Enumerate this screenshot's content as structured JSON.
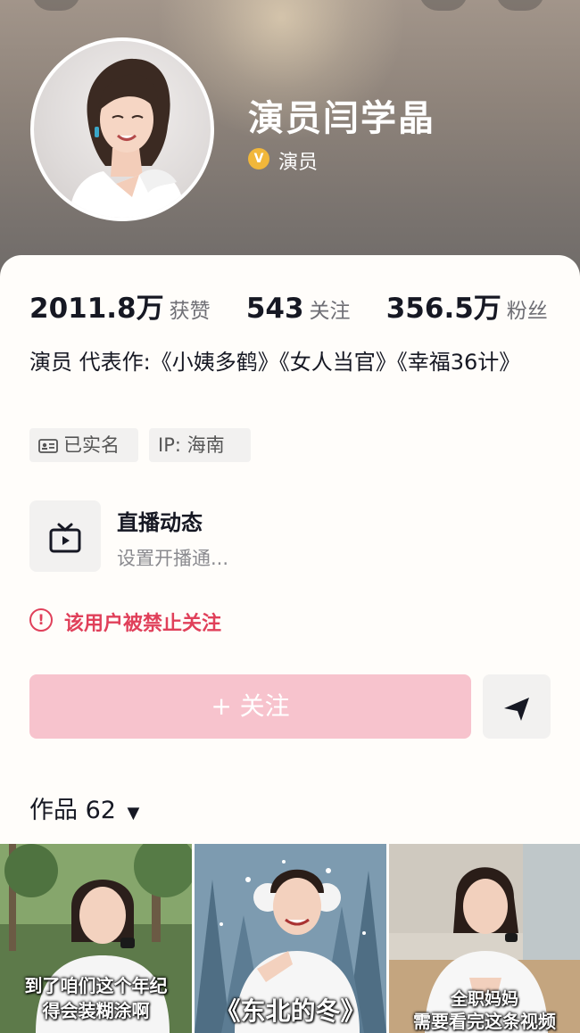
{
  "profile": {
    "name": "演员闫学晶",
    "verify_badge": "V",
    "role": "演员"
  },
  "stats": [
    {
      "value": "2011.8万",
      "label": "获赞"
    },
    {
      "value": "543",
      "label": "关注"
    },
    {
      "value": "356.5万",
      "label": "粉丝"
    }
  ],
  "bio": "演员 代表作:《小姨多鹤》《女人当官》《幸福36计》",
  "tags": {
    "verified": "已实名",
    "ip": "IP:  海南"
  },
  "live": {
    "title": "直播动态",
    "subtitle": "设置开播通..."
  },
  "warning": {
    "icon": "!",
    "text": "该用户被禁止关注"
  },
  "actions": {
    "follow_label": "+ 关注",
    "share_icon": "send-icon"
  },
  "works": {
    "label": "作品 62",
    "arrow": "▼"
  },
  "videos": [
    {
      "caption_line1": "到了咱们这个年纪",
      "caption_line2": "得会装糊涂啊"
    },
    {
      "caption_line1": "《东北的冬》"
    },
    {
      "caption_line1": "全职妈妈",
      "caption_line2": "需要看完这条视频"
    }
  ],
  "colors": {
    "accent": "#e0405a",
    "follow_disabled": "#f7c3cd",
    "verify_gold": "#f1b73a"
  }
}
